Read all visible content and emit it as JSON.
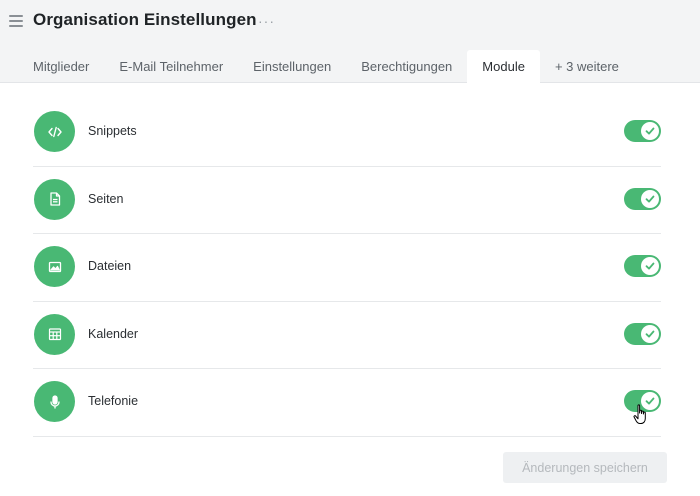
{
  "header": {
    "title": "Organisation Einstellungen",
    "more_label": "···",
    "menu_icon": "hamburger-menu-icon"
  },
  "tabs": [
    {
      "label": "Mitglieder",
      "active": false
    },
    {
      "label": "E-Mail Teilnehmer",
      "active": false
    },
    {
      "label": "Einstellungen",
      "active": false
    },
    {
      "label": "Berechtigungen",
      "active": false
    },
    {
      "label": "Module",
      "active": true
    },
    {
      "label": "+ 3 weitere",
      "active": false
    }
  ],
  "modules": [
    {
      "label": "Snippets",
      "icon": "code-icon",
      "enabled": true
    },
    {
      "label": "Seiten",
      "icon": "document-icon",
      "enabled": true
    },
    {
      "label": "Dateien",
      "icon": "image-icon",
      "enabled": true
    },
    {
      "label": "Kalender",
      "icon": "calendar-icon",
      "enabled": true
    },
    {
      "label": "Telefonie",
      "icon": "microphone-icon",
      "enabled": true
    }
  ],
  "footer": {
    "save_label": "Änderungen speichern",
    "save_enabled": false
  },
  "colors": {
    "accent": "#49b874",
    "header_bg": "#f3f4f5",
    "disabled_button_bg": "#eef0f2",
    "disabled_button_text": "#b5b9bd"
  }
}
